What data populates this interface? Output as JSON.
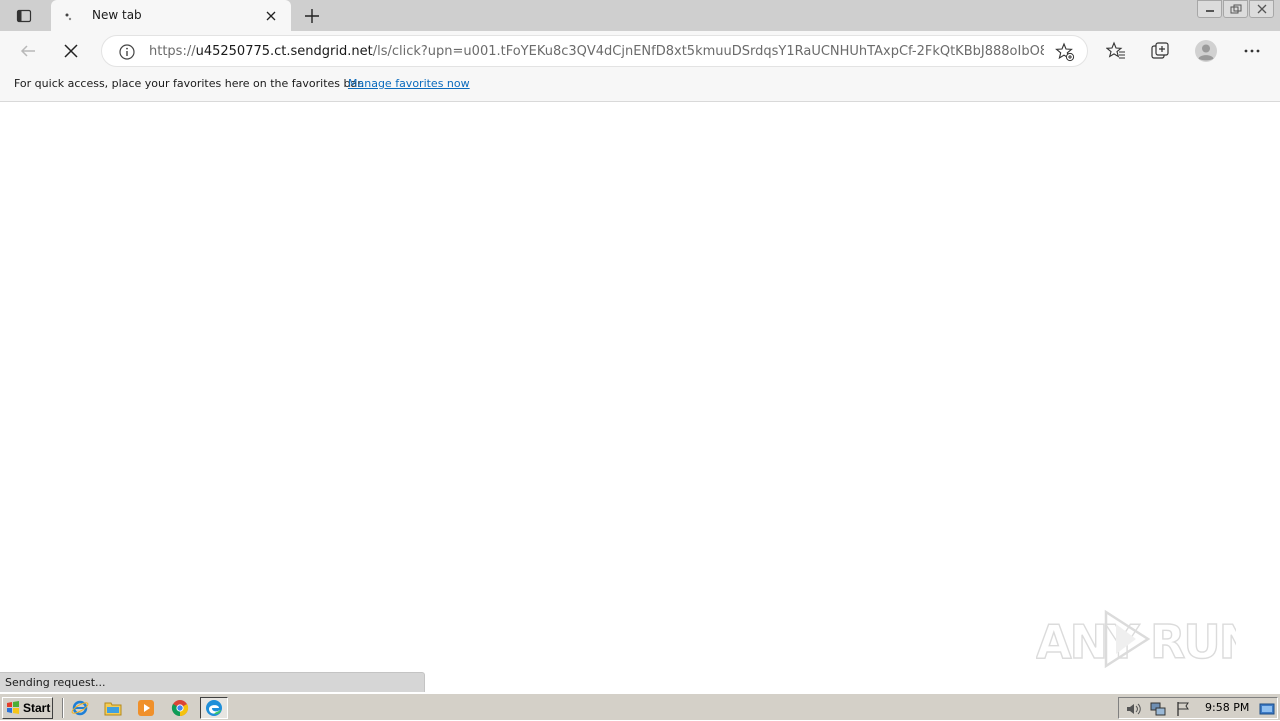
{
  "browser": {
    "tab": {
      "title": "New tab"
    },
    "address": {
      "scheme": "https://",
      "host": "u45250775.ct.sendgrid.net",
      "path": "/ls/click?upn=u001.tFoYEKu8c3QV4dCjnENfD8xt5kmuuDSrdqsY1RaUCNHUhTAxpCf-2FkQtKBbJ888oIbO8H_F..."
    },
    "favorites_bar": {
      "message": "For quick access, place your favorites here on the favorites bar.",
      "link": "Manage favorites now"
    },
    "status": "Sending request..."
  },
  "watermark": {
    "text": "ANY RUN"
  },
  "taskbar": {
    "start_label": "Start",
    "clock": "9:58 PM",
    "apps": [
      "internet-explorer-icon",
      "file-explorer-icon",
      "media-player-icon",
      "chrome-icon",
      "edge-icon"
    ]
  },
  "colors": {
    "link": "#0b6bbd",
    "tabstrip": "#cfcfcf",
    "taskbar": "#d4d0c8"
  }
}
